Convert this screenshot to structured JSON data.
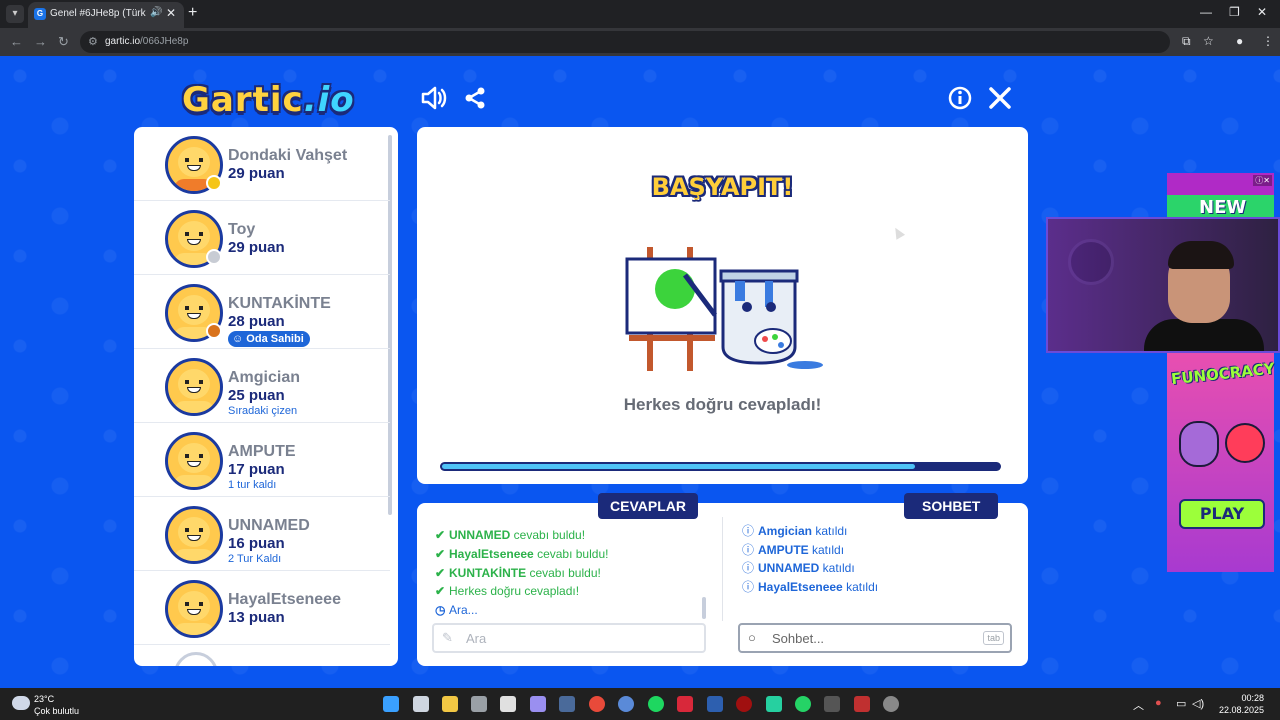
{
  "browser": {
    "tab_title": "Genel #6JHe8p (Türkçe) - G",
    "url_host": "gartic.io",
    "url_path": "/066JHe8p"
  },
  "game": {
    "logo_main": "Gartic",
    "logo_suffix": ".io",
    "players": [
      {
        "name": "Dondaki Vahşet",
        "score": "29 puan",
        "sub": "",
        "badge": "",
        "dot_color": "#f5c518",
        "avatar": "orange"
      },
      {
        "name": "Toy",
        "score": "29 puan",
        "sub": "",
        "badge": "",
        "dot_color": "#c8ccd4",
        "avatar": "yellow"
      },
      {
        "name": "KUNTAKİNTE",
        "score": "28 puan",
        "sub": "",
        "badge": "Oda Sahibi",
        "dot_color": "#d9731c",
        "avatar": "yellow"
      },
      {
        "name": "Amgician",
        "score": "25 puan",
        "sub": "Sıradaki çizen",
        "badge": "",
        "dot_color": "",
        "avatar": "yellow"
      },
      {
        "name": "AMPUTE",
        "score": "17 puan",
        "sub": "1 tur kaldı",
        "badge": "",
        "dot_color": "",
        "avatar": "yellow"
      },
      {
        "name": "UNNAMED",
        "score": "16 puan",
        "sub": "2 Tur Kaldı",
        "badge": "",
        "dot_color": "",
        "avatar": "yellow"
      },
      {
        "name": "HayalEtseneee",
        "score": "13 puan",
        "sub": "",
        "badge": "",
        "dot_color": "",
        "avatar": "yellow"
      }
    ],
    "stage": {
      "heading": "BAŞYAPIT!",
      "message": "Herkes doğru cevapladı!",
      "progress": 0.85
    },
    "answers": {
      "tab_label": "CEVAPLAR",
      "lines": [
        {
          "name": "UNNAMED",
          "text": " cevabı buldu!"
        },
        {
          "name": "HayalEtseneee",
          "text": " cevabı buldu!"
        },
        {
          "name": "KUNTAKİNTE",
          "text": " cevabı buldu!"
        }
      ],
      "everyone_line": "Herkes doğru cevapladı!",
      "waiting_line": "Ara...",
      "input_placeholder": "Ara"
    },
    "chat": {
      "tab_label": "SOHBET",
      "lines": [
        {
          "name": "Amgician",
          "text": " katıldı"
        },
        {
          "name": "AMPUTE",
          "text": " katıldı"
        },
        {
          "name": "UNNAMED",
          "text": " katıldı"
        },
        {
          "name": "HayalEtseneee",
          "text": " katıldı"
        }
      ],
      "input_placeholder": "Sohbet...",
      "tab_hint": "tab"
    }
  },
  "ads": {
    "new_text": "NEW",
    "brand": "FUNOCRACY",
    "play_label": "PLAY"
  },
  "taskbar": {
    "temperature": "23°C",
    "condition": "Çok bulutlu",
    "time": "00:28",
    "date": "22.08.2025"
  },
  "colors": {
    "game_background": "#0a56f0",
    "navy": "#1b2a7a",
    "answer_green": "#2cb24a",
    "link_blue": "#1e66d8"
  }
}
